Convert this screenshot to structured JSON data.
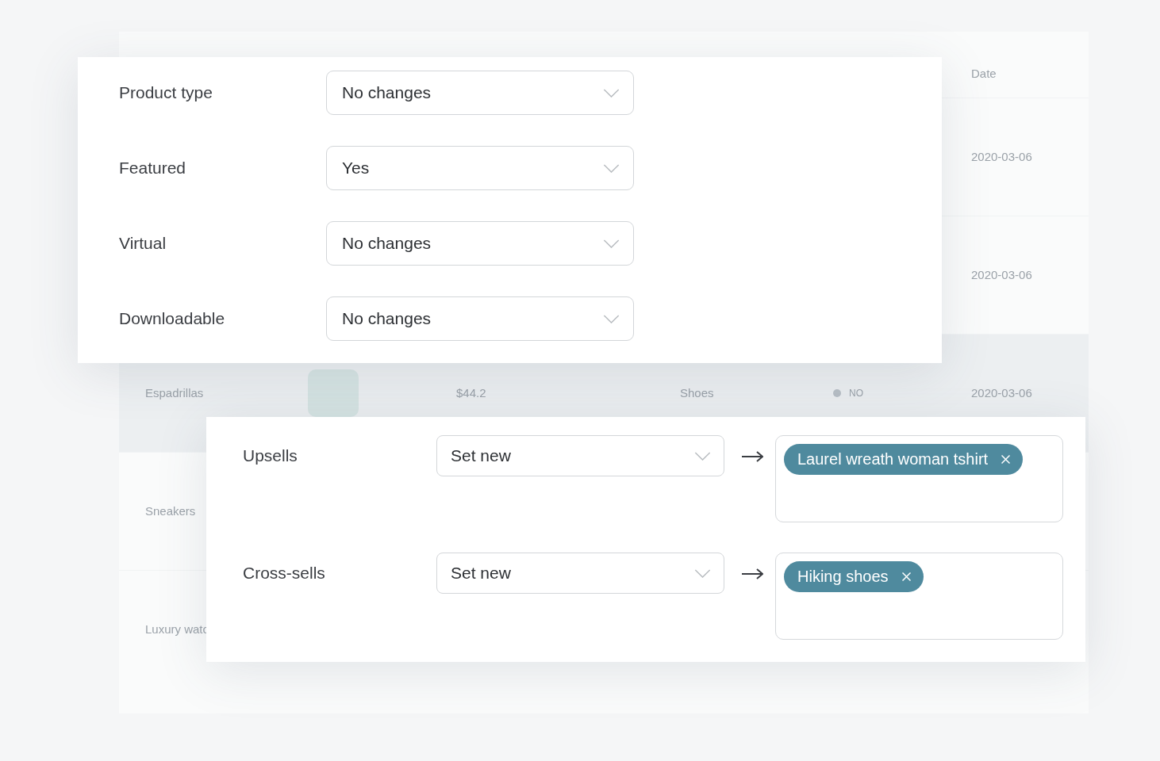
{
  "background_table": {
    "header": {
      "date": "Date"
    },
    "rows": [
      {
        "date": "2020-03-06",
        "highlighted": false
      },
      {
        "date": "2020-03-06",
        "highlighted": false
      },
      {
        "name": "Espadrillas",
        "photo": true,
        "price": "$44.2",
        "category": "Shoes",
        "status": "NO",
        "date": "2020-03-06",
        "highlighted": true
      },
      {
        "name": "Sneakers",
        "highlighted": false
      },
      {
        "name": "Luxury watc",
        "highlighted": false
      }
    ]
  },
  "general_panel": {
    "fields": [
      {
        "label": "Product type",
        "value": "No changes"
      },
      {
        "label": "Featured",
        "value": "Yes"
      },
      {
        "label": "Virtual",
        "value": "No changes"
      },
      {
        "label": "Downloadable",
        "value": "No changes"
      }
    ]
  },
  "linked_products_panel": {
    "fields": [
      {
        "label": "Upsells",
        "action": "Set new",
        "tags": [
          "Laurel wreath woman tshirt"
        ]
      },
      {
        "label": "Cross-sells",
        "action": "Set new",
        "tags": [
          "Hiking shoes"
        ]
      }
    ]
  }
}
